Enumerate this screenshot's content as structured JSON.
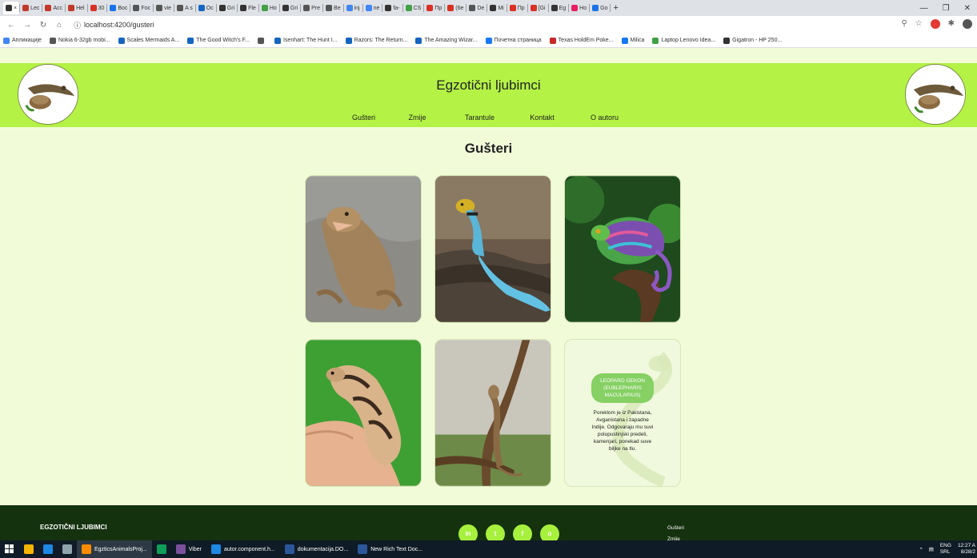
{
  "browser": {
    "tabs": [
      {
        "label": "",
        "color": "#333333"
      },
      {
        "label": "Lec",
        "color": "#c0392b"
      },
      {
        "label": "Acc",
        "color": "#c0392b"
      },
      {
        "label": "Hel",
        "color": "#c0392b"
      },
      {
        "label": "30",
        "color": "#d93025"
      },
      {
        "label": "Boc",
        "color": "#1a73e8"
      },
      {
        "label": "Foc",
        "color": "#555555"
      },
      {
        "label": "vie",
        "color": "#555555"
      },
      {
        "label": "A s",
        "color": "#555555"
      },
      {
        "label": "Oc",
        "color": "#1565c0"
      },
      {
        "label": "Gri",
        "color": "#333333"
      },
      {
        "label": "Fle",
        "color": "#333333"
      },
      {
        "label": "Ho",
        "color": "#43a047"
      },
      {
        "label": "Gri",
        "color": "#333333"
      },
      {
        "label": "Pre",
        "color": "#555555"
      },
      {
        "label": "Be",
        "color": "#555555"
      },
      {
        "label": "inj",
        "color": "#4285f4"
      },
      {
        "label": "ne",
        "color": "#4285f4"
      },
      {
        "label": "fa-",
        "color": "#333333"
      },
      {
        "label": "CS",
        "color": "#43a047"
      },
      {
        "label": "Пр",
        "color": "#d93025"
      },
      {
        "label": "(6e",
        "color": "#d93025"
      },
      {
        "label": "De",
        "color": "#555555"
      },
      {
        "label": "Mi",
        "color": "#333333"
      },
      {
        "label": "Пр",
        "color": "#d93025"
      },
      {
        "label": "[Gi",
        "color": "#d93025"
      },
      {
        "label": "Eg",
        "color": "#333333"
      },
      {
        "label": "Ho",
        "color": "#e91e63"
      },
      {
        "label": "Go",
        "color": "#1a73e8"
      }
    ],
    "new_tab": "+",
    "url": "localhost:4200/gusteri",
    "bookmarks": [
      {
        "label": "Апликације",
        "color": "#4285f4"
      },
      {
        "label": "Nokia 6-32gb mobi...",
        "color": "#555555"
      },
      {
        "label": "Scales Mermaids A...",
        "color": "#1565c0"
      },
      {
        "label": "The Good Witch's F...",
        "color": "#1565c0"
      },
      {
        "label": "",
        "color": "#555555"
      },
      {
        "label": "Isenhart: The Hunt I...",
        "color": "#1565c0"
      },
      {
        "label": "Razors: The Return...",
        "color": "#1565c0"
      },
      {
        "label": "The Amazing Wizar...",
        "color": "#1565c0"
      },
      {
        "label": "Почетна страница",
        "color": "#1877f2"
      },
      {
        "label": "Texas HoldEm Poke...",
        "color": "#c62828"
      },
      {
        "label": "Milica",
        "color": "#1877f2"
      },
      {
        "label": "Laptop Lenovo Idea...",
        "color": "#43a047"
      },
      {
        "label": "Gigatron - HP 250...",
        "color": "#333333"
      }
    ]
  },
  "site": {
    "title": "Egzotični ljubimci",
    "nav": [
      "Gušteri",
      "Zmije",
      "Tarantule",
      "Kontakt",
      "O autoru"
    ],
    "heading": "Gušteri",
    "info_card": {
      "title": "LEOPARD GEKON (EUBLEPHARIS MACULARIUS)",
      "text": "Poreklom je iz Pakistana, Avganistana i zapadne Indije. Odgovaraju mu suvi polupustinjski predeli, kamenjari, ponekad suve biljke na tlu."
    },
    "footer": {
      "brand": "EGZOTIČNI LJUBIMCI",
      "social": [
        "in",
        "t",
        "f",
        "o"
      ],
      "links": [
        "Gušteri",
        "Zmije"
      ]
    }
  },
  "taskbar": {
    "items": [
      {
        "label": "",
        "color": "#f4b400"
      },
      {
        "label": "",
        "color": "#1e88e5"
      },
      {
        "label": "",
        "color": "#90a4ae"
      },
      {
        "label": "EgzticsAnimalsProj...",
        "color": "#fb8c00",
        "active": true
      },
      {
        "label": "",
        "color": "#0f9d58"
      },
      {
        "label": "Viber",
        "color": "#7b519d"
      },
      {
        "label": "autor.component.h...",
        "color": "#1e88e5"
      },
      {
        "label": "dokumentacija.DO...",
        "color": "#2b579a"
      },
      {
        "label": "New Rich Text Doc...",
        "color": "#2b579a"
      }
    ],
    "lang": "ENG",
    "lang2": "SRL",
    "time": "12:27 A",
    "date": "8/28/2"
  }
}
